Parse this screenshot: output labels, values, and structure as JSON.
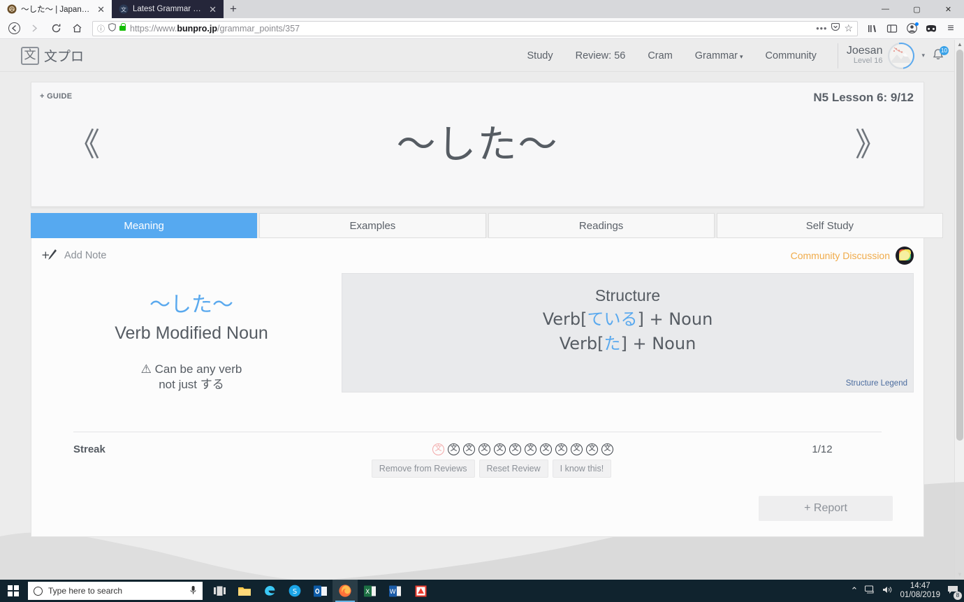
{
  "browser": {
    "tabs": [
      {
        "title": "〜した〜 | Japanese Grammar S",
        "favicon": "bunpro-favicon",
        "active": true
      },
      {
        "title": "Latest Grammar Points topics -",
        "favicon": "discourse-favicon",
        "active": false
      }
    ],
    "new_tab_label": "+",
    "window_controls": {
      "minimize": "—",
      "maximize": "▢",
      "close": "✕"
    },
    "nav": {
      "back": "←",
      "forward": "→",
      "reload": "⟳",
      "home": "⌂"
    },
    "url": {
      "prefix": "https://www.",
      "domain": "bunpro.jp",
      "path": "/grammar_points/357"
    },
    "url_icons": {
      "info": "ⓘ",
      "shield": "shield-icon",
      "lock": "lock-icon"
    },
    "urlbar_right": {
      "more": "•••",
      "pocket": "pocket-icon",
      "bookmark": "☆"
    },
    "toolbar_right": {
      "library": "library-icon",
      "sidebar": "sidebar-icon",
      "account": "account-icon",
      "mask": "container-icon",
      "menu": "≡"
    }
  },
  "site": {
    "brand_mark": "文",
    "brand_text": "文プロ",
    "nav": [
      {
        "label": "Study"
      },
      {
        "label": "Review: 56"
      },
      {
        "label": "Cram"
      },
      {
        "label": "Grammar",
        "caret": "▾"
      },
      {
        "label": "Community"
      }
    ],
    "user": {
      "name": "Joesan",
      "level": "Level 16",
      "caret": "▾"
    },
    "bell_badge": "10"
  },
  "grammar": {
    "guide_label": "+ GUIDE",
    "lesson_label": "N5 Lesson 6: 9/12",
    "title": "〜した〜",
    "prev_arrow": "《",
    "next_arrow": "》",
    "tabs": [
      {
        "label": "Meaning",
        "active": true
      },
      {
        "label": "Examples",
        "active": false
      },
      {
        "label": "Readings",
        "active": false
      },
      {
        "label": "Self Study",
        "active": false
      }
    ],
    "add_note": {
      "icon": "add-note-pencil-icon",
      "label": "Add Note"
    },
    "community_discussion": {
      "label": "Community Discussion",
      "icon": "discourse-icon"
    },
    "meaning": {
      "japanese": "〜した〜",
      "english": "Verb Modified Noun",
      "caution_glyph": "⚠",
      "caution_line1": "Can be any verb",
      "caution_line2": "not just する"
    },
    "structure": {
      "title": "Structure",
      "lines": [
        {
          "pre": "Verb[",
          "kana": "ている",
          "post": "] + Noun"
        },
        {
          "pre": "Verb[",
          "kana": "た",
          "post": "] + Noun"
        }
      ],
      "legend_label": "Structure Legend"
    },
    "streak": {
      "label": "Streak",
      "count": "1/12",
      "total_dots": 12,
      "current_index": 0,
      "dot_glyph": "文",
      "buttons": [
        {
          "label": "Remove from Reviews"
        },
        {
          "label": "Reset Review"
        },
        {
          "label": "I know this!"
        }
      ]
    },
    "report_button": "+ Report"
  },
  "taskbar": {
    "search_placeholder": "Type here to search",
    "icons": [
      {
        "name": "task-view-icon"
      },
      {
        "name": "file-explorer-icon"
      },
      {
        "name": "edge-icon"
      },
      {
        "name": "skype-icon"
      },
      {
        "name": "outlook-icon"
      },
      {
        "name": "firefox-icon",
        "active": true
      },
      {
        "name": "excel-icon"
      },
      {
        "name": "word-icon"
      },
      {
        "name": "anki-icon"
      }
    ],
    "tray": {
      "chevron": "⌃",
      "network": "network-icon",
      "volume": "volume-icon",
      "time": "14:47",
      "date": "01/08/2019",
      "notifications": "8"
    }
  },
  "colors": {
    "accent_blue": "#56a9f0",
    "link_orange": "#f0ab4a",
    "text_gray": "#565c63",
    "page_bg": "#ececec",
    "structure_bg": "#e9eaec"
  }
}
